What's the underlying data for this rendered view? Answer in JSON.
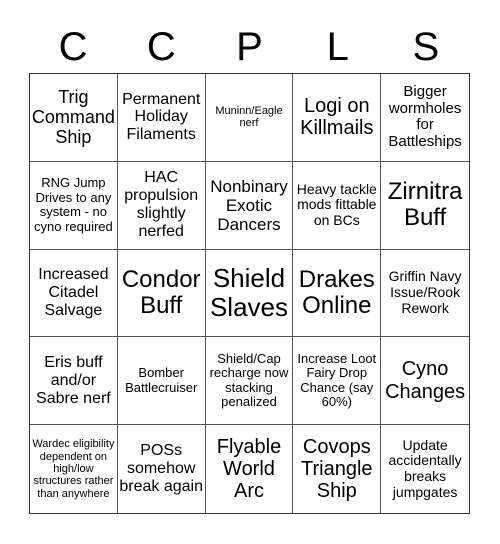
{
  "header": {
    "letters": [
      "C",
      "C",
      "P",
      "L",
      "S"
    ]
  },
  "board": {
    "cells": [
      "Trig Command Ship",
      "Permanent Holiday Filaments",
      "Muninn/Eagle nerf",
      "Logi on Killmails",
      "Bigger wormholes for Battleships",
      "RNG Jump Drives to any system - no cyno required",
      "HAC propulsion slightly nerfed",
      "Nonbinary Exotic Dancers",
      "Heavy tackle mods fittable on BCs",
      "Zirnitra Buff",
      "Increased Citadel Salvage",
      "Condor Buff",
      "Shield Slaves",
      "Drakes Online",
      "Griffin Navy Issue/Rook Rework",
      "Eris buff and/or Sabre nerf",
      "Bomber Battlecruiser",
      "Shield/Cap recharge now stacking penalized",
      "Increase Loot Fairy Drop Chance (say 60%)",
      "Cyno Changes",
      "Wardec eligibility dependent on high/low structures rather than anywhere",
      "POSs somehow break again",
      "Flyable World Arc",
      "Covops Triangle Ship",
      "Update accidentally breaks jumpgates"
    ]
  }
}
